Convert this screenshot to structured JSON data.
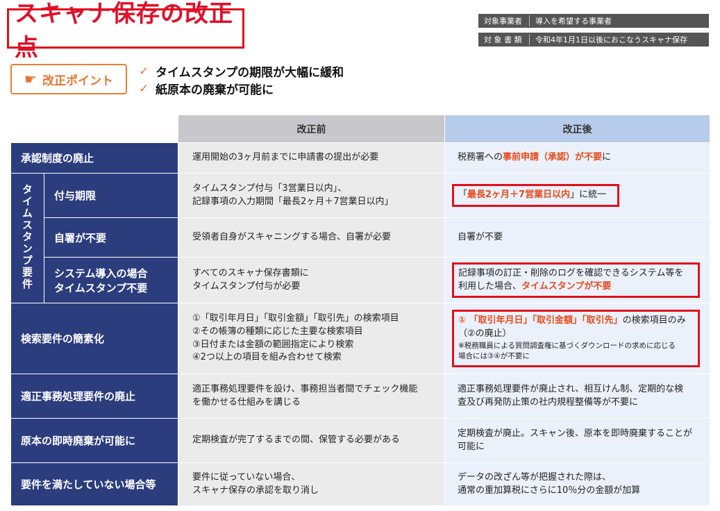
{
  "title": "スキャナ保存の改正点",
  "meta": [
    {
      "key": "対象事業者",
      "value": "導入を希望する事業者"
    },
    {
      "key": "対 象 書 類",
      "value": "令和4年1月1日以後におこなうスキャナ保存"
    }
  ],
  "point_label": "改正ポイント",
  "points": [
    "タイムスタンプの期限が大幅に緩和",
    "紙原本の廃棄が可能に"
  ],
  "headers": {
    "before": "改正前",
    "after": "改正後"
  },
  "group_label": "タイムスタンプ要件",
  "rows": {
    "r1": {
      "label": "承認制度の廃止",
      "before": "運用開始の3ヶ月前までに申請書の提出が必要",
      "after_pre": "税務署への",
      "after_red": "事前申請（承認）が不要",
      "after_post": "に"
    },
    "r2": {
      "label": "付与期限",
      "before1": "タイムスタンプ付与「3営業日以内」、",
      "before2": "記録事項の入力期間「最長2ヶ月＋7営業日以内」",
      "after_pre": "「",
      "after_red": "最長2ヶ月＋7営業日以内",
      "after_post": "」に統一"
    },
    "r3": {
      "label": "自署が不要",
      "before": "受領者自身がスキャニングする場合、自署が必要",
      "after": "自署が不要"
    },
    "r4": {
      "label1": "システム導入の場合",
      "label2": "タイムスタンプ不要",
      "before1": "すべてのスキャナ保存書類に",
      "before2": "タイムスタンプ付与が必要",
      "after1": "記録事項の訂正・削除のログを確認できるシステム等を",
      "after2_pre": "利用した場合、",
      "after2_red": "タイムスタンプが不要"
    },
    "r5": {
      "label": "検索要件の簡素化",
      "before": [
        "①「取引年月日」「取引金額」「取引先」の検索項目",
        "②その帳簿の種類に応じた主要な検索項目",
        "③日付または金額の範囲指定により検索",
        "④2つ以上の項目を組み合わせて検索"
      ],
      "after_num": "① ",
      "after_red": "「取引年月日」「取引金額」「取引先」",
      "after_post": "の検索項目のみ",
      "after_line2": "（②の廃止）",
      "after_note1": "※税務職員による質問調査権に基づくダウンロードの求めに応じる",
      "after_note2": "場合には③④が不要に"
    },
    "r6": {
      "label": "適正事務処理要件の廃止",
      "before1": "適正事務処理要件を設け、事務担当者間でチェック機能",
      "before2": "を働かせる仕組みを講じる",
      "after1": "適正事務処理要件が廃止され、相互けん制、定期的な検",
      "after2": "査及び再発防止策の社内規程整備等が不要に"
    },
    "r7": {
      "label": "原本の即時廃棄が可能に",
      "before": "定期検査が完了するまでの間、保管する必要がある",
      "after1": "定期検査が廃止。スキャン後、原本を即時廃棄することが",
      "after2": "可能に"
    },
    "r8": {
      "label": "要件を満たしていない場合等",
      "before1": "要件に従っていない場合、",
      "before2": "スキャナ保存の承認を取り消し",
      "after1": "データの改ざん等が把握された際は、",
      "after2": "通常の重加算税にさらに10％分の金額が加算"
    }
  },
  "colors": {
    "accent_red": "#e0101a",
    "navy": "#2c3d7e",
    "orange": "#e8762c",
    "highlight_text": "#e64a1a"
  }
}
